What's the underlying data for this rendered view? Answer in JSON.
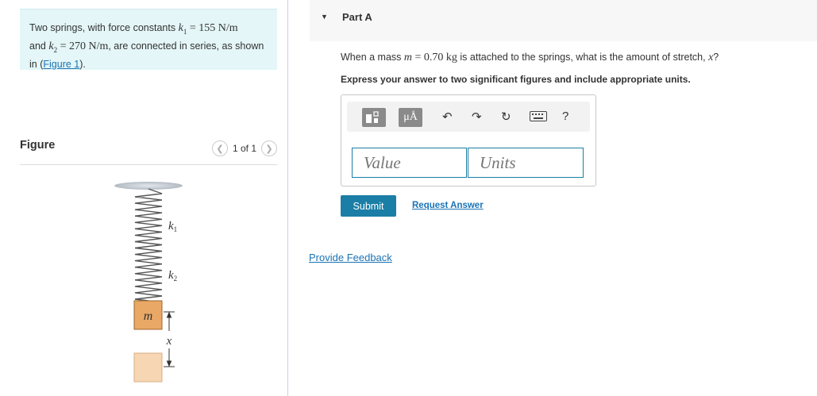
{
  "problem": {
    "text_1": "Two springs, with force constants ",
    "k1_value": "155 N/m",
    "text_2": "and ",
    "k2_value": "270 N/m",
    "text_3": ", are connected in series, as shown in (",
    "figure_link": "Figure 1",
    "text_4": ")."
  },
  "figure": {
    "title": "Figure",
    "pager_text": "1 of 1",
    "label_k1": "k",
    "label_k2": "k",
    "sub_1": "1",
    "sub_2": "2",
    "label_m": "m",
    "label_x": "x"
  },
  "part": {
    "title": "Part A",
    "question_1": "When a mass ",
    "mass_value": "0.70 kg",
    "question_2": " is attached to the springs, what is the amount of stretch, ",
    "question_3": "?",
    "instruction": "Express your answer to two significant figures and include appropriate units."
  },
  "toolbar": {
    "mu_label": "μÅ",
    "help_label": "?"
  },
  "inputs": {
    "value_placeholder": "Value",
    "units_placeholder": "Units"
  },
  "actions": {
    "submit": "Submit",
    "request_answer": "Request Answer",
    "feedback": "Provide Feedback"
  },
  "colors": {
    "accent": "#1b7ea6",
    "problem_bg": "#e4f6f7",
    "link": "#1a73b6"
  }
}
